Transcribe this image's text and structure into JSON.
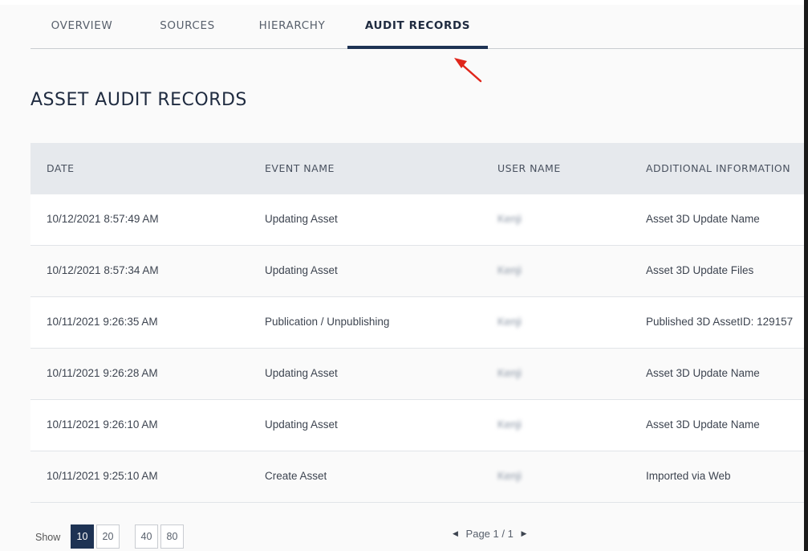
{
  "tabs": [
    {
      "label": "OVERVIEW"
    },
    {
      "label": "SOURCES"
    },
    {
      "label": "HIERARCHY"
    },
    {
      "label": "AUDIT RECORDS",
      "active": true
    }
  ],
  "page_title": "ASSET AUDIT RECORDS",
  "table": {
    "headers": [
      "DATE",
      "EVENT NAME",
      "USER NAME",
      "ADDITIONAL INFORMATION"
    ],
    "rows": [
      {
        "date": "10/12/2021 8:57:49 AM",
        "event": "Updating Asset",
        "user": "Kenji",
        "info": "Asset 3D Update Name"
      },
      {
        "date": "10/12/2021 8:57:34 AM",
        "event": "Updating Asset",
        "user": "Kenji",
        "info": "Asset 3D Update Files"
      },
      {
        "date": "10/11/2021 9:26:35 AM",
        "event": "Publication / Unpublishing",
        "user": "Kenji",
        "info": "Published 3D AssetID: 129157"
      },
      {
        "date": "10/11/2021 9:26:28 AM",
        "event": "Updating Asset",
        "user": "Kenji",
        "info": "Asset 3D Update Name"
      },
      {
        "date": "10/11/2021 9:26:10 AM",
        "event": "Updating Asset",
        "user": "Kenji",
        "info": "Asset 3D Update Name"
      },
      {
        "date": "10/11/2021 9:25:10 AM",
        "event": "Create Asset",
        "user": "Kenji",
        "info": "Imported via Web"
      }
    ]
  },
  "pagination": {
    "show_label": "Show",
    "page_sizes": [
      "10",
      "20",
      "40",
      "80"
    ],
    "selected_size": "10",
    "page_text": "Page 1 / 1",
    "prev_icon": "caret-left-icon",
    "next_icon": "caret-right-icon"
  },
  "colors": {
    "accent": "#1e3354",
    "header_bg": "#e6e9ed",
    "annotation_arrow": "#e0261b"
  }
}
